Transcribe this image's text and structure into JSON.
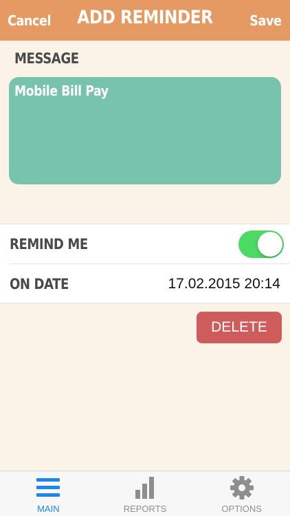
{
  "header": {
    "cancel_label": "Cancel",
    "title": "ADD REMINDER",
    "save_label": "Save",
    "color": "#e49a62"
  },
  "message": {
    "label": "MESSAGE",
    "value": "Mobile Bill Pay",
    "color": "#78c3ac"
  },
  "settings": {
    "remind_label": "REMIND ME",
    "remind_on": true,
    "date_label": "ON DATE",
    "date_value": "17.02.2015 20:14"
  },
  "delete_label": "DELETE",
  "tabs": [
    {
      "label": "MAIN",
      "icon": "menu-icon",
      "active": true
    },
    {
      "label": "REPORTS",
      "icon": "bar-chart-icon",
      "active": false
    },
    {
      "label": "OPTIONS",
      "icon": "gear-icon",
      "active": false
    }
  ]
}
